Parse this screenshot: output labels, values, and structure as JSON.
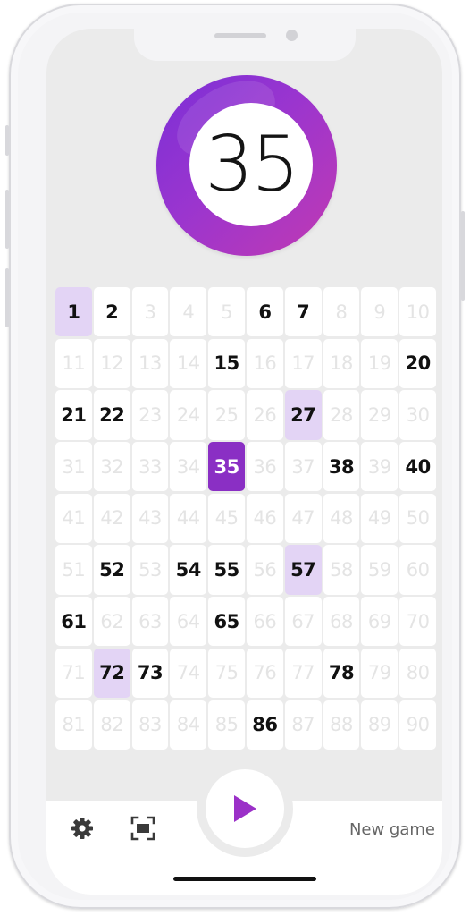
{
  "current_ball": {
    "number": "35"
  },
  "board": {
    "cells": [
      "1",
      "2",
      "3",
      "4",
      "5",
      "6",
      "7",
      "8",
      "9",
      "10",
      "11",
      "12",
      "13",
      "14",
      "15",
      "16",
      "17",
      "18",
      "19",
      "20",
      "21",
      "22",
      "23",
      "24",
      "25",
      "26",
      "27",
      "28",
      "29",
      "30",
      "31",
      "32",
      "33",
      "34",
      "35",
      "36",
      "37",
      "38",
      "39",
      "40",
      "41",
      "42",
      "43",
      "44",
      "45",
      "46",
      "47",
      "48",
      "49",
      "50",
      "51",
      "52",
      "53",
      "54",
      "55",
      "56",
      "57",
      "58",
      "59",
      "60",
      "61",
      "62",
      "63",
      "64",
      "65",
      "66",
      "67",
      "68",
      "69",
      "70",
      "71",
      "72",
      "73",
      "74",
      "75",
      "76",
      "77",
      "78",
      "79",
      "80",
      "81",
      "82",
      "83",
      "84",
      "85",
      "86",
      "87",
      "88",
      "89",
      "90"
    ],
    "called_numbers": [
      1,
      2,
      6,
      7,
      15,
      20,
      21,
      22,
      27,
      35,
      38,
      40,
      52,
      54,
      55,
      57,
      61,
      65,
      72,
      73,
      78,
      86
    ],
    "recent_numbers": [
      1,
      27,
      57,
      72
    ],
    "current_number": 35
  },
  "controls": {
    "play_icon": "play-icon",
    "settings_icon": "gear-icon",
    "scan_icon": "scan-icon",
    "new_game_label": "New game"
  },
  "colors": {
    "accent": "#8a2fc4",
    "highlight": "#e3d4f5",
    "play": "#9b30c8"
  }
}
